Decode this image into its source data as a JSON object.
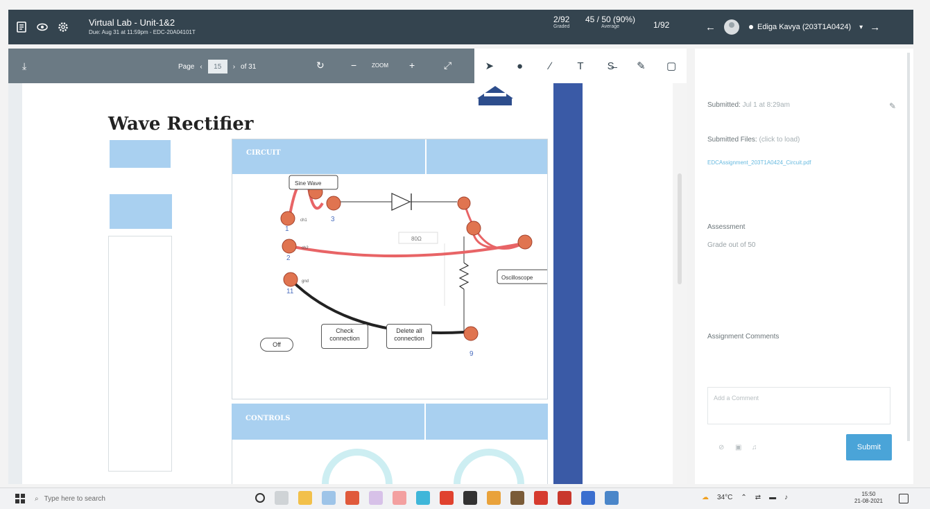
{
  "header": {
    "title": "Virtual Lab - Unit-1&2",
    "subtitle": "Due: Aug 31 at 11:59pm - EDC-20A04101T",
    "graded_value": "2/92",
    "graded_label": "Graded",
    "average_value": "45 / 50 (90%)",
    "average_label": "Average",
    "position": "1/92",
    "student_name": "Ediga Kavya (203T1A0424)"
  },
  "doc_toolbar": {
    "page_label": "Page",
    "page_value": "15",
    "page_total": "of 31",
    "zoom_label": "ZOOM"
  },
  "document": {
    "heading": "Wave Rectifier",
    "circuit_label": "CIRCUIT",
    "controls_label": "CONTROLS",
    "sine_wave_label": "Sine Wave",
    "oscilloscope_label": "Oscilloscope",
    "check_connection": "Check connection",
    "delete_all": "Delete all connection",
    "off_label": "Off",
    "resistor_value": "80Ω",
    "node_labels": [
      "1",
      "2",
      "3",
      "11",
      "9"
    ],
    "terminal_labels": [
      "ch1",
      "ch2",
      "gnd"
    ]
  },
  "right_panel": {
    "submitted_label": "Submitted:",
    "submitted_value": "Jul 1 at 8:29am",
    "files_label": "Submitted Files:",
    "files_hint": "(click to load)",
    "file_name": "EDCAssignment_203T1A0424_Circuit.pdf",
    "assessment_label": "Assessment",
    "grade_label": "Grade out of 50",
    "comments_label": "Assignment Comments",
    "comment_placeholder": "Add a Comment",
    "submit_label": "Submit"
  },
  "taskbar": {
    "search_placeholder": "Type here to search",
    "temperature": "34°C",
    "time": "15:50",
    "date": "21-08-2021"
  }
}
